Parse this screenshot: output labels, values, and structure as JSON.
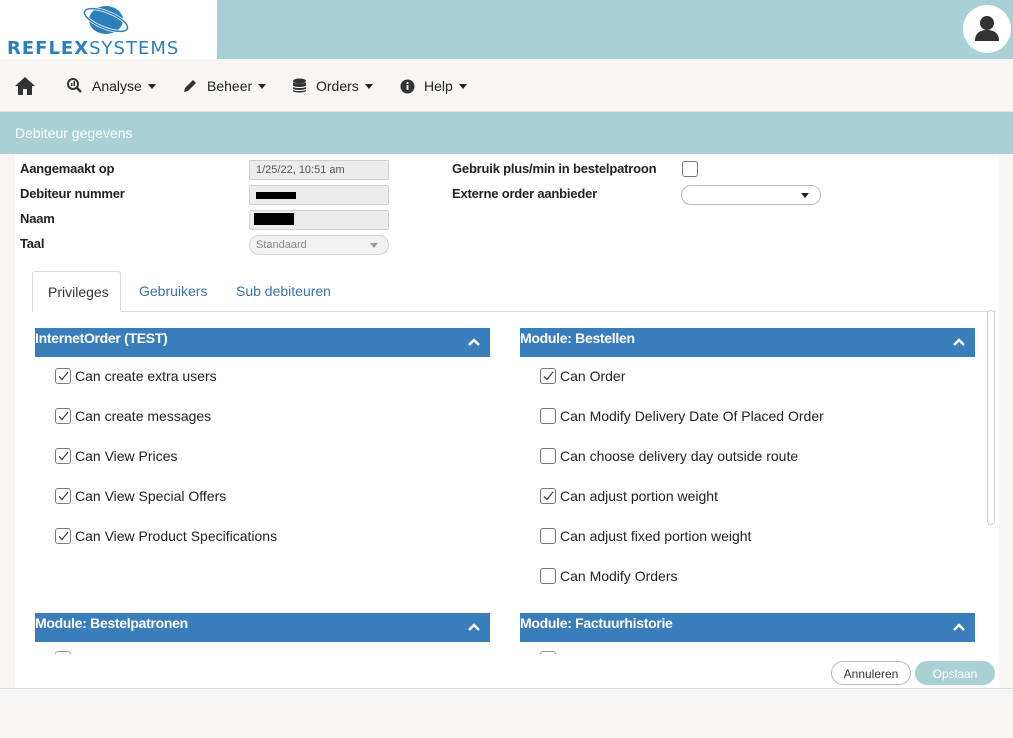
{
  "brand": {
    "name_bold": "REFLEX",
    "name_light": "SYSTEMS",
    "color": "#2c7fbd"
  },
  "colors": {
    "header_bg": "#a9d0d5",
    "section_header": "#3a7dbb",
    "tab_link": "#3a74a8"
  },
  "nav": {
    "home_icon": "home-icon",
    "items": [
      {
        "label": "Analyse",
        "icon": "search-chart-icon"
      },
      {
        "label": "Beheer",
        "icon": "pencil-icon"
      },
      {
        "label": "Orders",
        "icon": "database-icon"
      },
      {
        "label": "Help",
        "icon": "info-circle-icon"
      }
    ]
  },
  "page_title": "Debiteur gegevens",
  "form": {
    "created_label": "Aangemaakt op",
    "created_value": "1/25/22, 10:51 am",
    "debtor_number_label": "Debiteur nummer",
    "name_label": "Naam",
    "language_label": "Taal",
    "language_value": "Standaard",
    "plusmin_label": "Gebruik plus/min in bestelpatroon",
    "plusmin_checked": false,
    "external_order_label": "Externe order aanbieder",
    "external_order_value": ""
  },
  "tabs": [
    {
      "label": "Privileges",
      "active": true
    },
    {
      "label": "Gebruikers",
      "active": false
    },
    {
      "label": "Sub debiteuren",
      "active": false
    }
  ],
  "sections": {
    "internetorder": {
      "title": "InternetOrder (TEST)",
      "items": [
        {
          "label": "Can create extra users",
          "checked": true
        },
        {
          "label": "Can create messages",
          "checked": true
        },
        {
          "label": "Can View Prices",
          "checked": true
        },
        {
          "label": "Can View Special Offers",
          "checked": true
        },
        {
          "label": "Can View Product Specifications",
          "checked": true
        }
      ]
    },
    "bestellen": {
      "title": "Module: Bestellen",
      "items": [
        {
          "label": "Can Order",
          "checked": true
        },
        {
          "label": "Can Modify Delivery Date Of Placed Order",
          "checked": false
        },
        {
          "label": "Can choose delivery day outside route",
          "checked": false
        },
        {
          "label": "Can adjust portion weight",
          "checked": true
        },
        {
          "label": "Can adjust fixed portion weight",
          "checked": false
        },
        {
          "label": "Can Modify Orders",
          "checked": false
        }
      ]
    },
    "bestelpatronen": {
      "title": "Module: Bestelpatronen"
    },
    "factuurhistorie": {
      "title": "Module: Factuurhistorie"
    }
  },
  "buttons": {
    "cancel": "Annuleren",
    "save": "Opslaan"
  }
}
